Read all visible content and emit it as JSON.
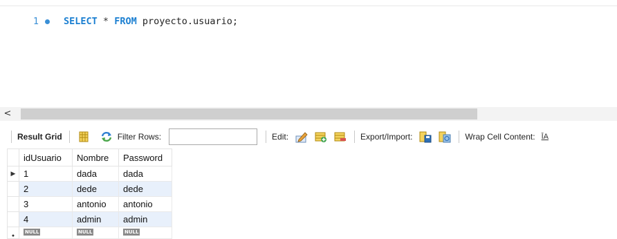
{
  "editor": {
    "line_number": "1",
    "tokens": {
      "select": "SELECT",
      "star": "*",
      "from": "FROM",
      "table": "proyecto.usuario;"
    }
  },
  "scroll": {
    "left_arrow": "<"
  },
  "toolbar": {
    "result_grid": "Result Grid",
    "filter_label": "Filter Rows:",
    "filter_value": "",
    "edit_label": "Edit:",
    "export_label": "Export/Import:",
    "wrap_label": "Wrap Cell Content:",
    "wrap_glyph": "ĪA"
  },
  "grid": {
    "columns": [
      "idUsuario",
      "Nombre",
      "Password"
    ],
    "rows": [
      {
        "marker": "▶",
        "cells": [
          "1",
          "dada",
          "dada"
        ]
      },
      {
        "marker": "",
        "cells": [
          "2",
          "dede",
          "dede"
        ]
      },
      {
        "marker": "",
        "cells": [
          "3",
          "antonio",
          "antonio"
        ]
      },
      {
        "marker": "",
        "cells": [
          "4",
          "admin",
          "admin"
        ]
      }
    ],
    "new_row_marker": "●",
    "null_text": "NULL"
  },
  "colors": {
    "keyword": "#1b7fd1",
    "alt_row": "#e8f0fb",
    "scroll_thumb": "#cfcfcf"
  }
}
